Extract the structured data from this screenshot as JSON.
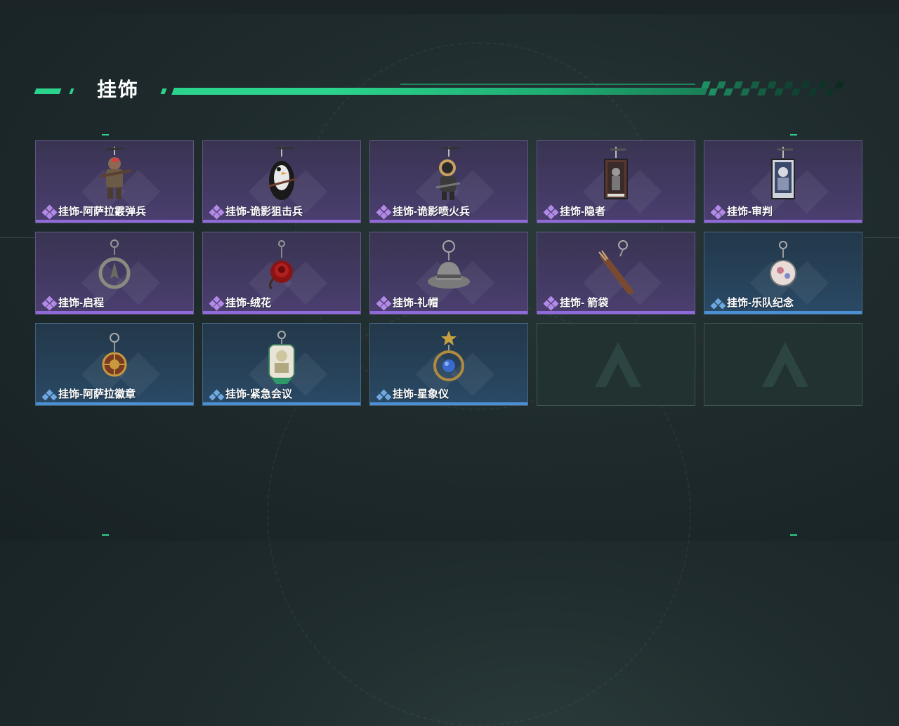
{
  "section": {
    "title": "挂饰"
  },
  "colors": {
    "accent": "#2bd38c",
    "epic_bar": "#8f6ad8",
    "rare_bar": "#4b8fd4"
  },
  "items": [
    {
      "label": "挂饰-阿萨拉霰弹兵",
      "rarity": "epic",
      "icon": "soldier-shotgun-charm-icon"
    },
    {
      "label": "挂饰-诡影狙击兵",
      "rarity": "epic",
      "icon": "penguin-sniper-charm-icon"
    },
    {
      "label": "挂饰-诡影喷火兵",
      "rarity": "epic",
      "icon": "flamethrower-soldier-charm-icon"
    },
    {
      "label": "挂饰-隐者",
      "rarity": "epic",
      "icon": "hermit-tarot-card-icon"
    },
    {
      "label": "挂饰-审判",
      "rarity": "epic",
      "icon": "judgement-tarot-card-icon"
    },
    {
      "label": "挂饰-启程",
      "rarity": "epic",
      "icon": "departure-ring-charm-icon"
    },
    {
      "label": "挂饰-绒花",
      "rarity": "epic",
      "icon": "velvet-rose-charm-icon"
    },
    {
      "label": "挂饰-礼帽",
      "rarity": "epic",
      "icon": "fedora-hat-charm-icon"
    },
    {
      "label": "挂饰- 箭袋",
      "rarity": "epic",
      "icon": "quiver-charm-icon"
    },
    {
      "label": "挂饰-乐队纪念",
      "rarity": "rare",
      "icon": "band-badge-charm-icon"
    },
    {
      "label": "挂饰-阿萨拉徽章",
      "rarity": "rare",
      "icon": "asara-emblem-charm-icon"
    },
    {
      "label": "挂饰-紧急会议",
      "rarity": "rare",
      "icon": "emergency-meeting-charm-icon"
    },
    {
      "label": "挂饰-星象仪",
      "rarity": "rare",
      "icon": "astrolabe-charm-icon"
    }
  ]
}
